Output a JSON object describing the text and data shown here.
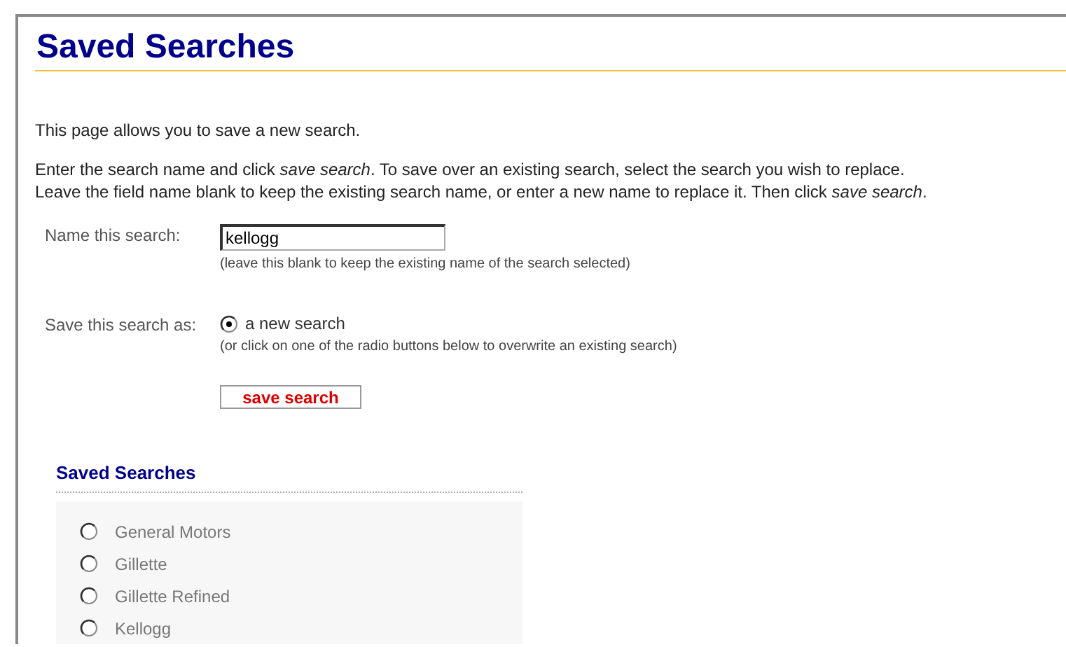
{
  "title": "Saved Searches",
  "intro": "This page allows you to save a new search.",
  "instructions": [
    "Enter the search name and click *save search*. To save over an existing search, select the search you wish to replace.",
    "Leave the field name blank to keep the existing search name, or enter a new name to replace it. Then click *save search*."
  ],
  "name_field": {
    "label": "Name this search:",
    "value": "kellogg",
    "hint": "(leave this blank to keep the existing name of the search selected)"
  },
  "save_as": {
    "label": "Save this search as:",
    "option": "a new search",
    "selected": true,
    "hint": "(or click on one of the radio buttons below to overwrite an existing search)"
  },
  "save_button": "save search",
  "saved_searches": {
    "heading": "Saved Searches",
    "items": [
      {
        "label": "General Motors",
        "selected": false
      },
      {
        "label": "Gillette",
        "selected": false
      },
      {
        "label": "Gillette Refined",
        "selected": false
      },
      {
        "label": "Kellogg",
        "selected": false
      }
    ]
  }
}
